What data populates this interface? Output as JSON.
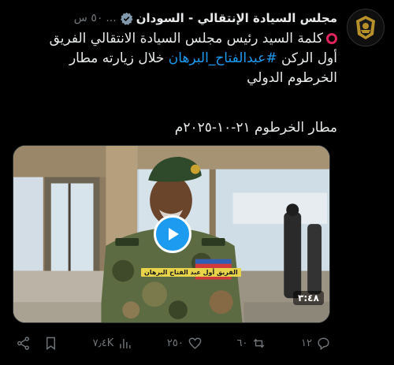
{
  "account": {
    "name": "مجلس السيادة الإنتقالي - السودان",
    "handle": "...",
    "time": "٥٠ س",
    "verified_color": "#829aab"
  },
  "tweet": {
    "line1_prefix": "كلمة السيد رئيس مجلس السيادة الانتقالي الفريق",
    "line2_prefix": "أول الركن",
    "hashtag": "#عبدالفتاح_البرهان",
    "line2_suffix": "خلال زيارته مطار",
    "line3": "الخرطوم الدولي",
    "para2": "مطار الخرطوم ٢١-١٠-٢٠٢٥م"
  },
  "media": {
    "duration": "٣:٤٨",
    "patch_text": "الفريق أول عبد الفتاح البرهان"
  },
  "actions": {
    "replies": "١٢",
    "reposts": "٦٠",
    "likes": "٢٥٠",
    "views": "٧٫٤K"
  },
  "colors": {
    "accent": "#1d9bf0",
    "muted": "#71767b",
    "emoji_red": "#e0245e"
  }
}
